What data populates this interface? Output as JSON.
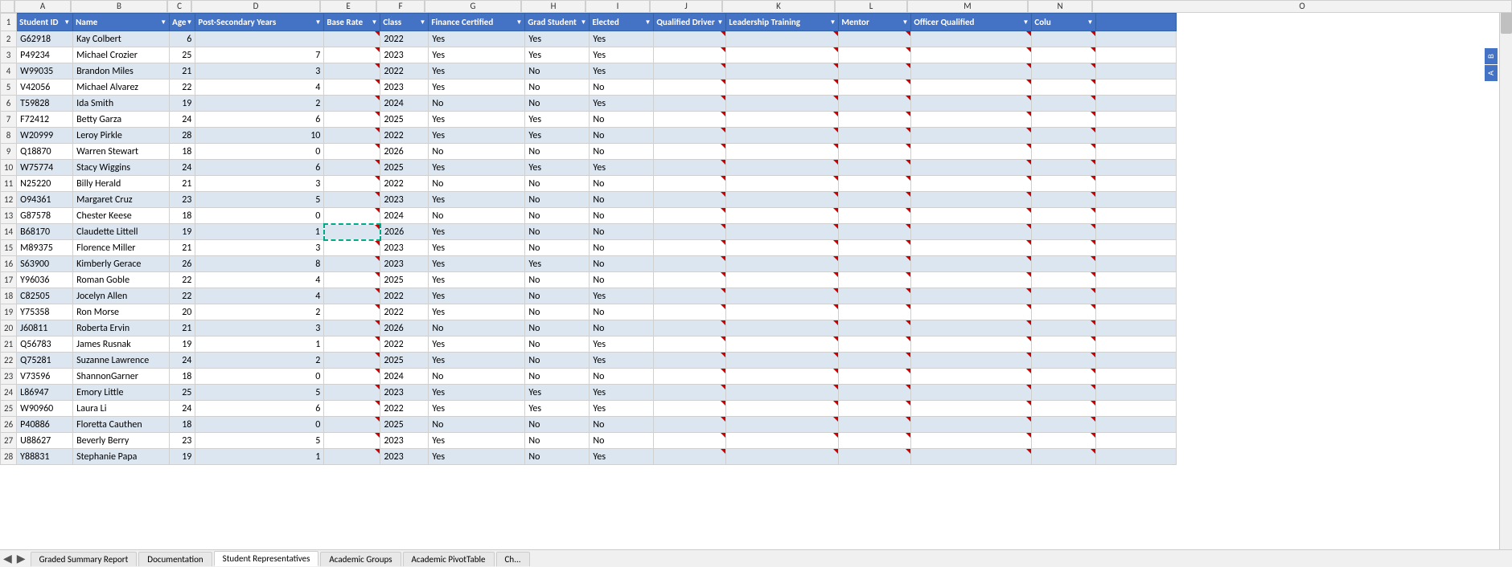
{
  "columns": {
    "letters": [
      "",
      "A",
      "B",
      "C",
      "D",
      "E",
      "F",
      "G",
      "H",
      "I",
      "J",
      "K",
      "L",
      "M",
      "N",
      "O"
    ],
    "headers": [
      {
        "label": "Student ID",
        "key": "student_id"
      },
      {
        "label": "Name",
        "key": "name"
      },
      {
        "label": "Age",
        "key": "age"
      },
      {
        "label": "Post-Secondary Years",
        "key": "post_secondary_years"
      },
      {
        "label": "Base Rate",
        "key": "base_rate"
      },
      {
        "label": "Class",
        "key": "class"
      },
      {
        "label": "Finance Certified",
        "key": "finance_certified"
      },
      {
        "label": "Grad Student",
        "key": "grad_student"
      },
      {
        "label": "Elected",
        "key": "elected"
      },
      {
        "label": "Qualified Driver",
        "key": "qualified_driver"
      },
      {
        "label": "Leadership Training",
        "key": "leadership_training"
      },
      {
        "label": "Mentor",
        "key": "mentor"
      },
      {
        "label": "Officer Qualified",
        "key": "officer_qualified"
      },
      {
        "label": "Colu",
        "key": "colu"
      }
    ]
  },
  "rows": [
    {
      "row_num": 2,
      "student_id": "G62918",
      "name": "Kay Colbert",
      "age": "6",
      "post_secondary_years": "",
      "base_rate": "",
      "class": "2022",
      "finance_certified": "Yes",
      "grad_student": "Yes",
      "elected": "Yes",
      "qualified_driver": "",
      "leadership_training": "",
      "mentor": "",
      "officer_qualified": "",
      "colu": ""
    },
    {
      "row_num": 3,
      "student_id": "P49234",
      "name": "Michael Crozier",
      "age": "25",
      "post_secondary_years": "7",
      "base_rate": "",
      "class": "2023",
      "finance_certified": "Yes",
      "grad_student": "Yes",
      "elected": "Yes",
      "qualified_driver": "",
      "leadership_training": "",
      "mentor": "",
      "officer_qualified": "",
      "colu": ""
    },
    {
      "row_num": 4,
      "student_id": "W99035",
      "name": "Brandon Miles",
      "age": "21",
      "post_secondary_years": "3",
      "base_rate": "",
      "class": "2022",
      "finance_certified": "Yes",
      "grad_student": "No",
      "elected": "Yes",
      "qualified_driver": "",
      "leadership_training": "",
      "mentor": "",
      "officer_qualified": "",
      "colu": ""
    },
    {
      "row_num": 5,
      "student_id": "V42056",
      "name": "Michael Alvarez",
      "age": "22",
      "post_secondary_years": "4",
      "base_rate": "",
      "class": "2023",
      "finance_certified": "Yes",
      "grad_student": "No",
      "elected": "No",
      "qualified_driver": "",
      "leadership_training": "",
      "mentor": "",
      "officer_qualified": "",
      "colu": ""
    },
    {
      "row_num": 6,
      "student_id": "T59828",
      "name": "Ida Smith",
      "age": "19",
      "post_secondary_years": "2",
      "base_rate": "",
      "class": "2024",
      "finance_certified": "No",
      "grad_student": "No",
      "elected": "Yes",
      "qualified_driver": "",
      "leadership_training": "",
      "mentor": "",
      "officer_qualified": "",
      "colu": ""
    },
    {
      "row_num": 7,
      "student_id": "F72412",
      "name": "Betty Garza",
      "age": "24",
      "post_secondary_years": "6",
      "base_rate": "",
      "class": "2025",
      "finance_certified": "Yes",
      "grad_student": "Yes",
      "elected": "No",
      "qualified_driver": "",
      "leadership_training": "",
      "mentor": "",
      "officer_qualified": "",
      "colu": ""
    },
    {
      "row_num": 8,
      "student_id": "W20999",
      "name": "Leroy Pirkle",
      "age": "28",
      "post_secondary_years": "10",
      "base_rate": "",
      "class": "2022",
      "finance_certified": "Yes",
      "grad_student": "Yes",
      "elected": "No",
      "qualified_driver": "",
      "leadership_training": "",
      "mentor": "",
      "officer_qualified": "",
      "colu": ""
    },
    {
      "row_num": 9,
      "student_id": "Q18870",
      "name": "Warren Stewart",
      "age": "18",
      "post_secondary_years": "0",
      "base_rate": "",
      "class": "2026",
      "finance_certified": "No",
      "grad_student": "No",
      "elected": "No",
      "qualified_driver": "",
      "leadership_training": "",
      "mentor": "",
      "officer_qualified": "",
      "colu": ""
    },
    {
      "row_num": 10,
      "student_id": "W75774",
      "name": "Stacy Wiggins",
      "age": "24",
      "post_secondary_years": "6",
      "base_rate": "",
      "class": "2025",
      "finance_certified": "Yes",
      "grad_student": "Yes",
      "elected": "Yes",
      "qualified_driver": "",
      "leadership_training": "",
      "mentor": "",
      "officer_qualified": "",
      "colu": ""
    },
    {
      "row_num": 11,
      "student_id": "N25220",
      "name": "Billy Herald",
      "age": "21",
      "post_secondary_years": "3",
      "base_rate": "",
      "class": "2022",
      "finance_certified": "No",
      "grad_student": "No",
      "elected": "No",
      "qualified_driver": "",
      "leadership_training": "",
      "mentor": "",
      "officer_qualified": "",
      "colu": ""
    },
    {
      "row_num": 12,
      "student_id": "O94361",
      "name": "Margaret Cruz",
      "age": "23",
      "post_secondary_years": "5",
      "base_rate": "",
      "class": "2023",
      "finance_certified": "Yes",
      "grad_student": "No",
      "elected": "No",
      "qualified_driver": "",
      "leadership_training": "",
      "mentor": "",
      "officer_qualified": "",
      "colu": ""
    },
    {
      "row_num": 13,
      "student_id": "G87578",
      "name": "Chester Keese",
      "age": "18",
      "post_secondary_years": "0",
      "base_rate": "",
      "class": "2024",
      "finance_certified": "No",
      "grad_student": "No",
      "elected": "No",
      "qualified_driver": "",
      "leadership_training": "",
      "mentor": "",
      "officer_qualified": "",
      "colu": ""
    },
    {
      "row_num": 14,
      "student_id": "B68170",
      "name": "Claudette Littell",
      "age": "19",
      "post_secondary_years": "1",
      "base_rate": "",
      "class": "2026",
      "finance_certified": "Yes",
      "grad_student": "No",
      "elected": "No",
      "qualified_driver": "",
      "leadership_training": "",
      "mentor": "",
      "officer_qualified": "",
      "colu": "",
      "dashed": true
    },
    {
      "row_num": 15,
      "student_id": "M89375",
      "name": "Florence Miller",
      "age": "21",
      "post_secondary_years": "3",
      "base_rate": "",
      "class": "2023",
      "finance_certified": "Yes",
      "grad_student": "No",
      "elected": "No",
      "qualified_driver": "",
      "leadership_training": "",
      "mentor": "",
      "officer_qualified": "",
      "colu": ""
    },
    {
      "row_num": 16,
      "student_id": "S63900",
      "name": "Kimberly Gerace",
      "age": "26",
      "post_secondary_years": "8",
      "base_rate": "",
      "class": "2023",
      "finance_certified": "Yes",
      "grad_student": "Yes",
      "elected": "No",
      "qualified_driver": "",
      "leadership_training": "",
      "mentor": "",
      "officer_qualified": "",
      "colu": ""
    },
    {
      "row_num": 17,
      "student_id": "Y96036",
      "name": "Roman Goble",
      "age": "22",
      "post_secondary_years": "4",
      "base_rate": "",
      "class": "2025",
      "finance_certified": "Yes",
      "grad_student": "No",
      "elected": "No",
      "qualified_driver": "",
      "leadership_training": "",
      "mentor": "",
      "officer_qualified": "",
      "colu": ""
    },
    {
      "row_num": 18,
      "student_id": "C82505",
      "name": "Jocelyn Allen",
      "age": "22",
      "post_secondary_years": "4",
      "base_rate": "",
      "class": "2022",
      "finance_certified": "Yes",
      "grad_student": "No",
      "elected": "Yes",
      "qualified_driver": "",
      "leadership_training": "",
      "mentor": "",
      "officer_qualified": "",
      "colu": ""
    },
    {
      "row_num": 19,
      "student_id": "Y75358",
      "name": "Ron Morse",
      "age": "20",
      "post_secondary_years": "2",
      "base_rate": "",
      "class": "2022",
      "finance_certified": "Yes",
      "grad_student": "No",
      "elected": "No",
      "qualified_driver": "",
      "leadership_training": "",
      "mentor": "",
      "officer_qualified": "",
      "colu": ""
    },
    {
      "row_num": 20,
      "student_id": "J60811",
      "name": "Roberta Ervin",
      "age": "21",
      "post_secondary_years": "3",
      "base_rate": "",
      "class": "2026",
      "finance_certified": "No",
      "grad_student": "No",
      "elected": "No",
      "qualified_driver": "",
      "leadership_training": "",
      "mentor": "",
      "officer_qualified": "",
      "colu": ""
    },
    {
      "row_num": 21,
      "student_id": "Q56783",
      "name": "James Rusnak",
      "age": "19",
      "post_secondary_years": "1",
      "base_rate": "",
      "class": "2022",
      "finance_certified": "Yes",
      "grad_student": "No",
      "elected": "Yes",
      "qualified_driver": "",
      "leadership_training": "",
      "mentor": "",
      "officer_qualified": "",
      "colu": ""
    },
    {
      "row_num": 22,
      "student_id": "Q75281",
      "name": "Suzanne Lawrence",
      "age": "24",
      "post_secondary_years": "2",
      "base_rate": "",
      "class": "2025",
      "finance_certified": "Yes",
      "grad_student": "No",
      "elected": "Yes",
      "qualified_driver": "",
      "leadership_training": "",
      "mentor": "",
      "officer_qualified": "",
      "colu": ""
    },
    {
      "row_num": 23,
      "student_id": "V73596",
      "name": "ShannonGarner",
      "age": "18",
      "post_secondary_years": "0",
      "base_rate": "",
      "class": "2024",
      "finance_certified": "No",
      "grad_student": "No",
      "elected": "No",
      "qualified_driver": "",
      "leadership_training": "",
      "mentor": "",
      "officer_qualified": "",
      "colu": ""
    },
    {
      "row_num": 24,
      "student_id": "L86947",
      "name": "Emory Little",
      "age": "25",
      "post_secondary_years": "5",
      "base_rate": "",
      "class": "2023",
      "finance_certified": "Yes",
      "grad_student": "Yes",
      "elected": "Yes",
      "qualified_driver": "",
      "leadership_training": "",
      "mentor": "",
      "officer_qualified": "",
      "colu": ""
    },
    {
      "row_num": 25,
      "student_id": "W90960",
      "name": "Laura Li",
      "age": "24",
      "post_secondary_years": "6",
      "base_rate": "",
      "class": "2022",
      "finance_certified": "Yes",
      "grad_student": "Yes",
      "elected": "Yes",
      "qualified_driver": "",
      "leadership_training": "",
      "mentor": "",
      "officer_qualified": "",
      "colu": ""
    },
    {
      "row_num": 26,
      "student_id": "P40886",
      "name": "Floretta Cauthen",
      "age": "18",
      "post_secondary_years": "0",
      "base_rate": "",
      "class": "2025",
      "finance_certified": "No",
      "grad_student": "No",
      "elected": "No",
      "qualified_driver": "",
      "leadership_training": "",
      "mentor": "",
      "officer_qualified": "",
      "colu": ""
    },
    {
      "row_num": 27,
      "student_id": "U88627",
      "name": "Beverly Berry",
      "age": "23",
      "post_secondary_years": "5",
      "base_rate": "",
      "class": "2023",
      "finance_certified": "Yes",
      "grad_student": "No",
      "elected": "No",
      "qualified_driver": "",
      "leadership_training": "",
      "mentor": "",
      "officer_qualified": "",
      "colu": ""
    },
    {
      "row_num": 28,
      "student_id": "Y88831",
      "name": "Stephanie Papa",
      "age": "19",
      "post_secondary_years": "1",
      "base_rate": "",
      "class": "2023",
      "finance_certified": "Yes",
      "grad_student": "No",
      "elected": "Yes",
      "qualified_driver": "",
      "leadership_training": "",
      "mentor": "",
      "officer_qualified": "",
      "colu": ""
    }
  ],
  "tabs": [
    {
      "label": "Graded Summary Report",
      "active": false
    },
    {
      "label": "Documentation",
      "active": false
    },
    {
      "label": "Student Representatives",
      "active": true
    },
    {
      "label": "Academic Groups",
      "active": false
    },
    {
      "label": "Academic PivotTable",
      "active": false
    },
    {
      "label": "Ch...",
      "active": false
    }
  ],
  "row1_label": "1",
  "side_buttons": [
    {
      "label": "B"
    },
    {
      "label": "A"
    }
  ]
}
